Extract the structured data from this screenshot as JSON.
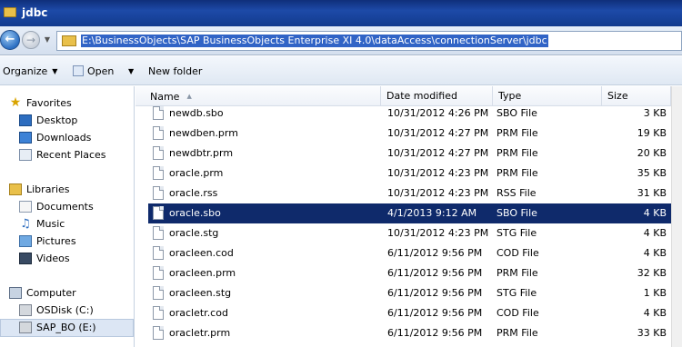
{
  "window": {
    "title": "jdbc"
  },
  "address": {
    "path": "E:\\BusinessObjects\\SAP BusinessObjects Enterprise XI 4.0\\dataAccess\\connectionServer\\jdbc"
  },
  "toolbar": {
    "organize": "Organize",
    "open": "Open",
    "new_folder": "New folder"
  },
  "sidebar": {
    "favorites": "Favorites",
    "desktop": "Desktop",
    "downloads": "Downloads",
    "recent": "Recent Places",
    "libraries": "Libraries",
    "documents": "Documents",
    "music": "Music",
    "pictures": "Pictures",
    "videos": "Videos",
    "computer": "Computer",
    "drive_c": "OSDisk (C:)",
    "drive_e": "SAP_BO (E:)"
  },
  "columns": {
    "name": "Name",
    "date": "Date modified",
    "type": "Type",
    "size": "Size"
  },
  "files": [
    {
      "name": "newdb.sbo",
      "date": "10/31/2012 4:26 PM",
      "type": "SBO File",
      "size": "3 KB"
    },
    {
      "name": "newdben.prm",
      "date": "10/31/2012 4:27 PM",
      "type": "PRM File",
      "size": "19 KB"
    },
    {
      "name": "newdbtr.prm",
      "date": "10/31/2012 4:27 PM",
      "type": "PRM File",
      "size": "20 KB"
    },
    {
      "name": "oracle.prm",
      "date": "10/31/2012 4:23 PM",
      "type": "PRM File",
      "size": "35 KB"
    },
    {
      "name": "oracle.rss",
      "date": "10/31/2012 4:23 PM",
      "type": "RSS File",
      "size": "31 KB"
    },
    {
      "name": "oracle.sbo",
      "date": "4/1/2013 9:12 AM",
      "type": "SBO File",
      "size": "4 KB"
    },
    {
      "name": "oracle.stg",
      "date": "10/31/2012 4:23 PM",
      "type": "STG File",
      "size": "4 KB"
    },
    {
      "name": "oracleen.cod",
      "date": "6/11/2012 9:56 PM",
      "type": "COD File",
      "size": "4 KB"
    },
    {
      "name": "oracleen.prm",
      "date": "6/11/2012 9:56 PM",
      "type": "PRM File",
      "size": "32 KB"
    },
    {
      "name": "oracleen.stg",
      "date": "6/11/2012 9:56 PM",
      "type": "STG File",
      "size": "1 KB"
    },
    {
      "name": "oracletr.cod",
      "date": "6/11/2012 9:56 PM",
      "type": "COD File",
      "size": "4 KB"
    },
    {
      "name": "oracletr.prm",
      "date": "6/11/2012 9:56 PM",
      "type": "PRM File",
      "size": "33 KB"
    }
  ]
}
